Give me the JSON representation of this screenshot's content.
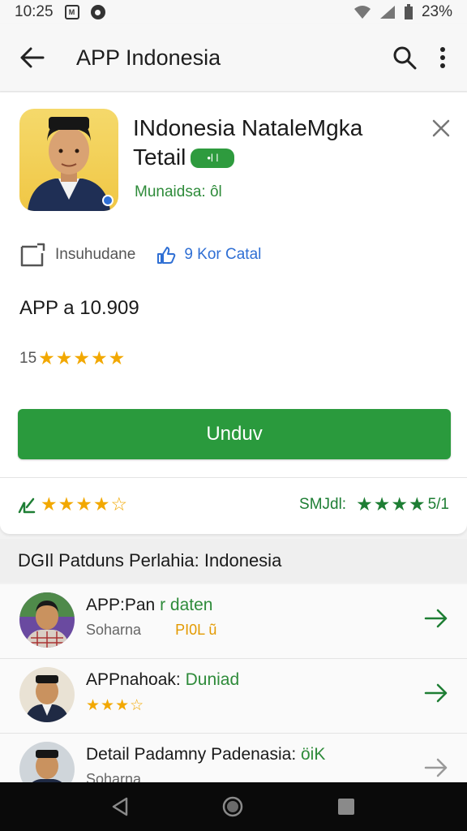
{
  "status_bar": {
    "time": "10:25",
    "notif_label": "M",
    "battery_text": "23%"
  },
  "app_bar": {
    "title": "APP Indonesia"
  },
  "developer": {
    "name_line1": "INdonesia NataleMgka",
    "name_line2": "Tetail",
    "pill": "•l l",
    "subtitle": "Munaidsa: ôl"
  },
  "meta": {
    "left_label": "Insuhudane",
    "right_label": "9 Kor Catal"
  },
  "version": "APP a 10.909",
  "rating": {
    "count": "15",
    "stars": "★★★★★"
  },
  "download_label": "Unduv",
  "bottom_row": {
    "left_stars": "★★★★☆",
    "right_label": "SMJdl:",
    "right_stars": "★★★★",
    "right_value": "5/1"
  },
  "section_title": "DGIl Patduns Perlahia: Indonesia",
  "list_items": [
    {
      "title": "APP:Pan",
      "accent": " r daten",
      "sub": "Soharna",
      "sub_accent": "PI0L ũ"
    },
    {
      "title": "APPnahoak:",
      "accent": " Duniad",
      "stars": "★★★☆"
    },
    {
      "title": "Detail Padamny Padenasia:",
      "accent": " öiK",
      "sub": "Soharna"
    }
  ],
  "colors": {
    "accent_green": "#2a9a3d",
    "link_blue": "#2f6fd4",
    "star_gold": "#f2a800"
  },
  "icons": [
    "back-arrow-icon",
    "search-icon",
    "more-vert-icon",
    "close-icon",
    "file-icon",
    "like-icon",
    "arrow-right-icon",
    "nav-back-icon",
    "nav-home-icon",
    "nav-recents-icon"
  ]
}
